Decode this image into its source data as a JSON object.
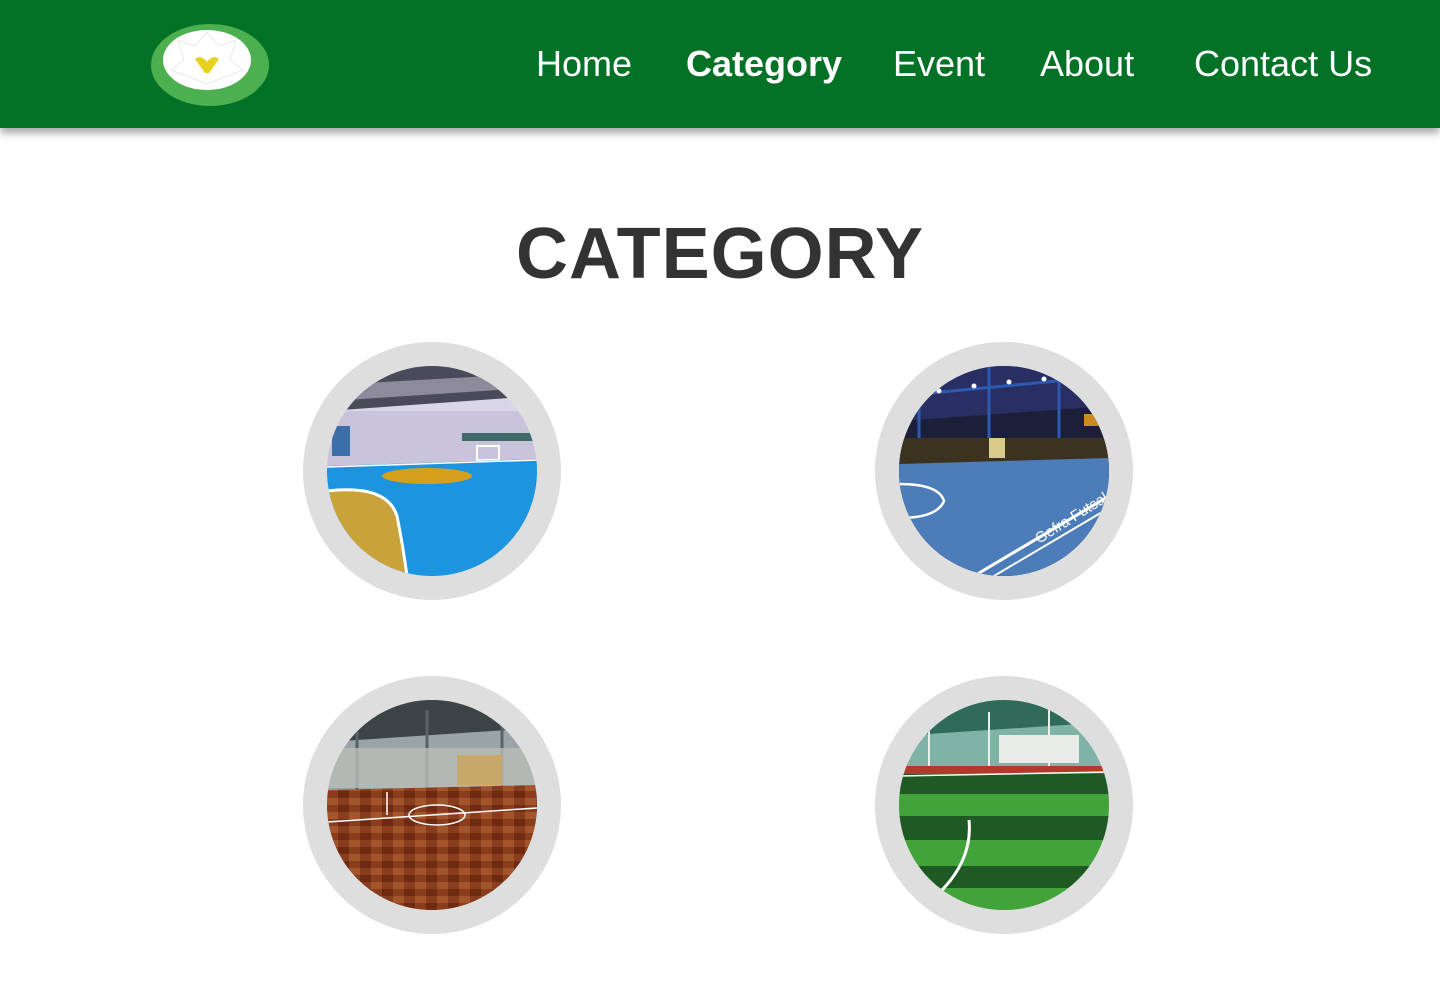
{
  "header": {
    "logo": {
      "icon": "lotus-icon",
      "colors": {
        "outer": "#4caf50",
        "petal": "#ffffff",
        "center": "#e6d21e"
      }
    },
    "nav": [
      {
        "label": "Home",
        "active": false
      },
      {
        "label": "Category",
        "active": true
      },
      {
        "label": "Event",
        "active": false
      },
      {
        "label": "About",
        "active": false
      },
      {
        "label": "Contact Us",
        "active": false
      }
    ]
  },
  "main": {
    "title": "CATEGORY",
    "categories": [
      {
        "image": "blue-vinyl-indoor-court"
      },
      {
        "image": "blue-interlock-indoor-court",
        "floor_text": "Gefra Futsal"
      },
      {
        "image": "wooden-parquet-court"
      },
      {
        "image": "synthetic-grass-field"
      }
    ]
  },
  "colors": {
    "header_bg": "#037226",
    "title": "#333333",
    "card_ring": "#dedede"
  }
}
